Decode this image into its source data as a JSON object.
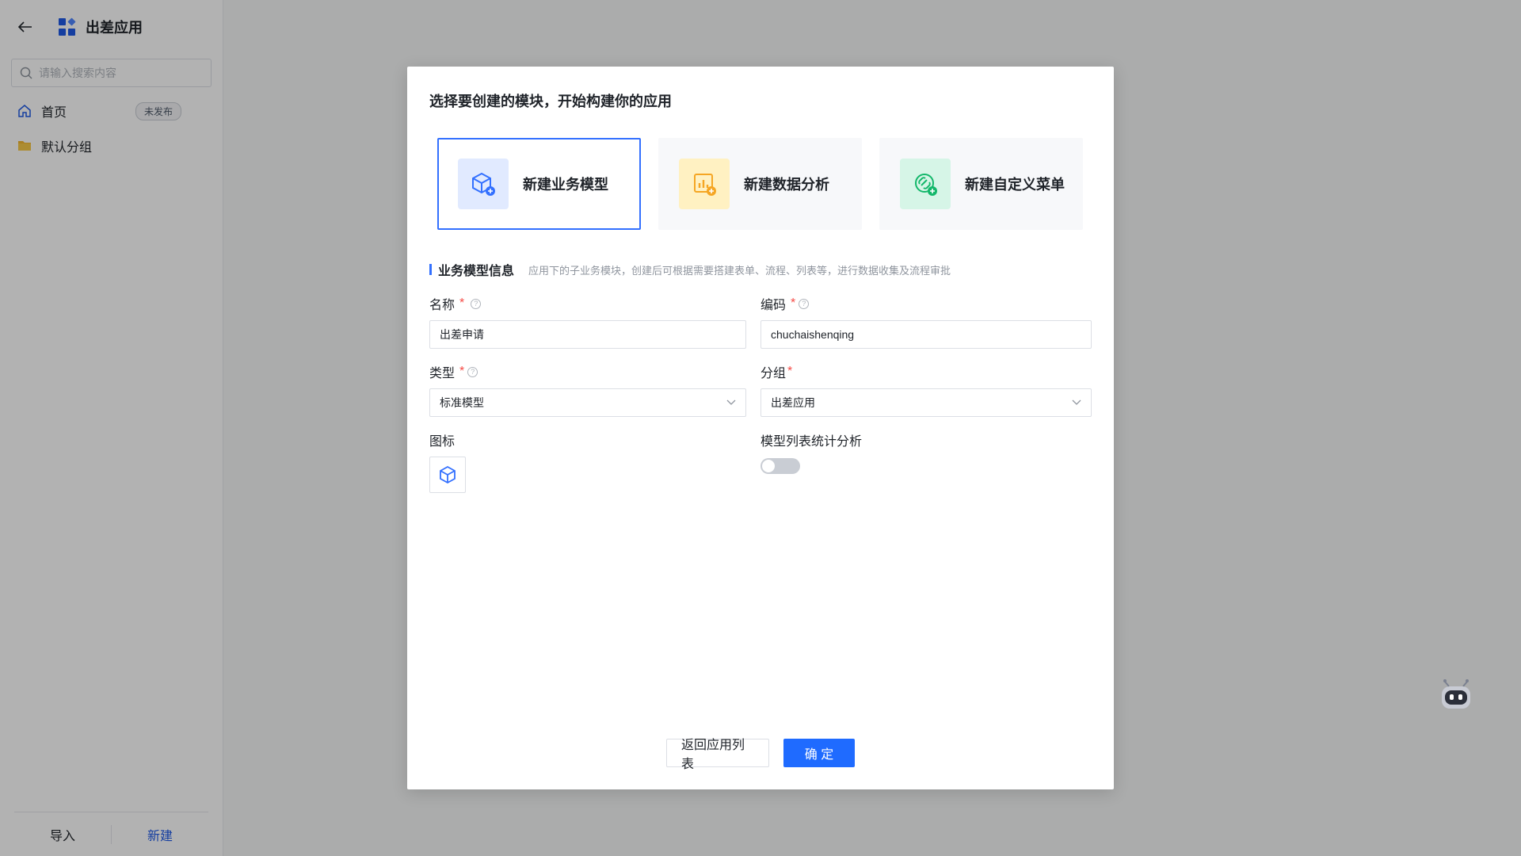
{
  "sidebar": {
    "app_title": "出差应用",
    "search_placeholder": "请输入搜索内容",
    "items": [
      {
        "label": "首页",
        "badge": "未发布"
      },
      {
        "label": "默认分组"
      }
    ],
    "footer": {
      "import": "导入",
      "new": "新建"
    }
  },
  "modal": {
    "title": "选择要创建的模块，开始构建你的应用",
    "cards": [
      {
        "label": "新建业务模型",
        "active": true
      },
      {
        "label": "新建数据分析"
      },
      {
        "label": "新建自定义菜单"
      }
    ],
    "section": {
      "title": "业务模型信息",
      "desc": "应用下的子业务模块，创建后可根据需要搭建表单、流程、列表等，进行数据收集及流程审批"
    },
    "fields": {
      "name": {
        "label": "名称",
        "value": "出差申请"
      },
      "code": {
        "label": "编码",
        "value": "chuchaishenqing"
      },
      "type": {
        "label": "类型",
        "value": "标准模型"
      },
      "group": {
        "label": "分组",
        "value": "出差应用"
      },
      "icon": {
        "label": "图标"
      },
      "stats": {
        "label": "模型列表统计分析",
        "enabled": false
      }
    },
    "buttons": {
      "back": "返回应用列表",
      "confirm": "确 定"
    }
  },
  "colors": {
    "primary": "#1f6bff",
    "required": "#f54a45"
  }
}
